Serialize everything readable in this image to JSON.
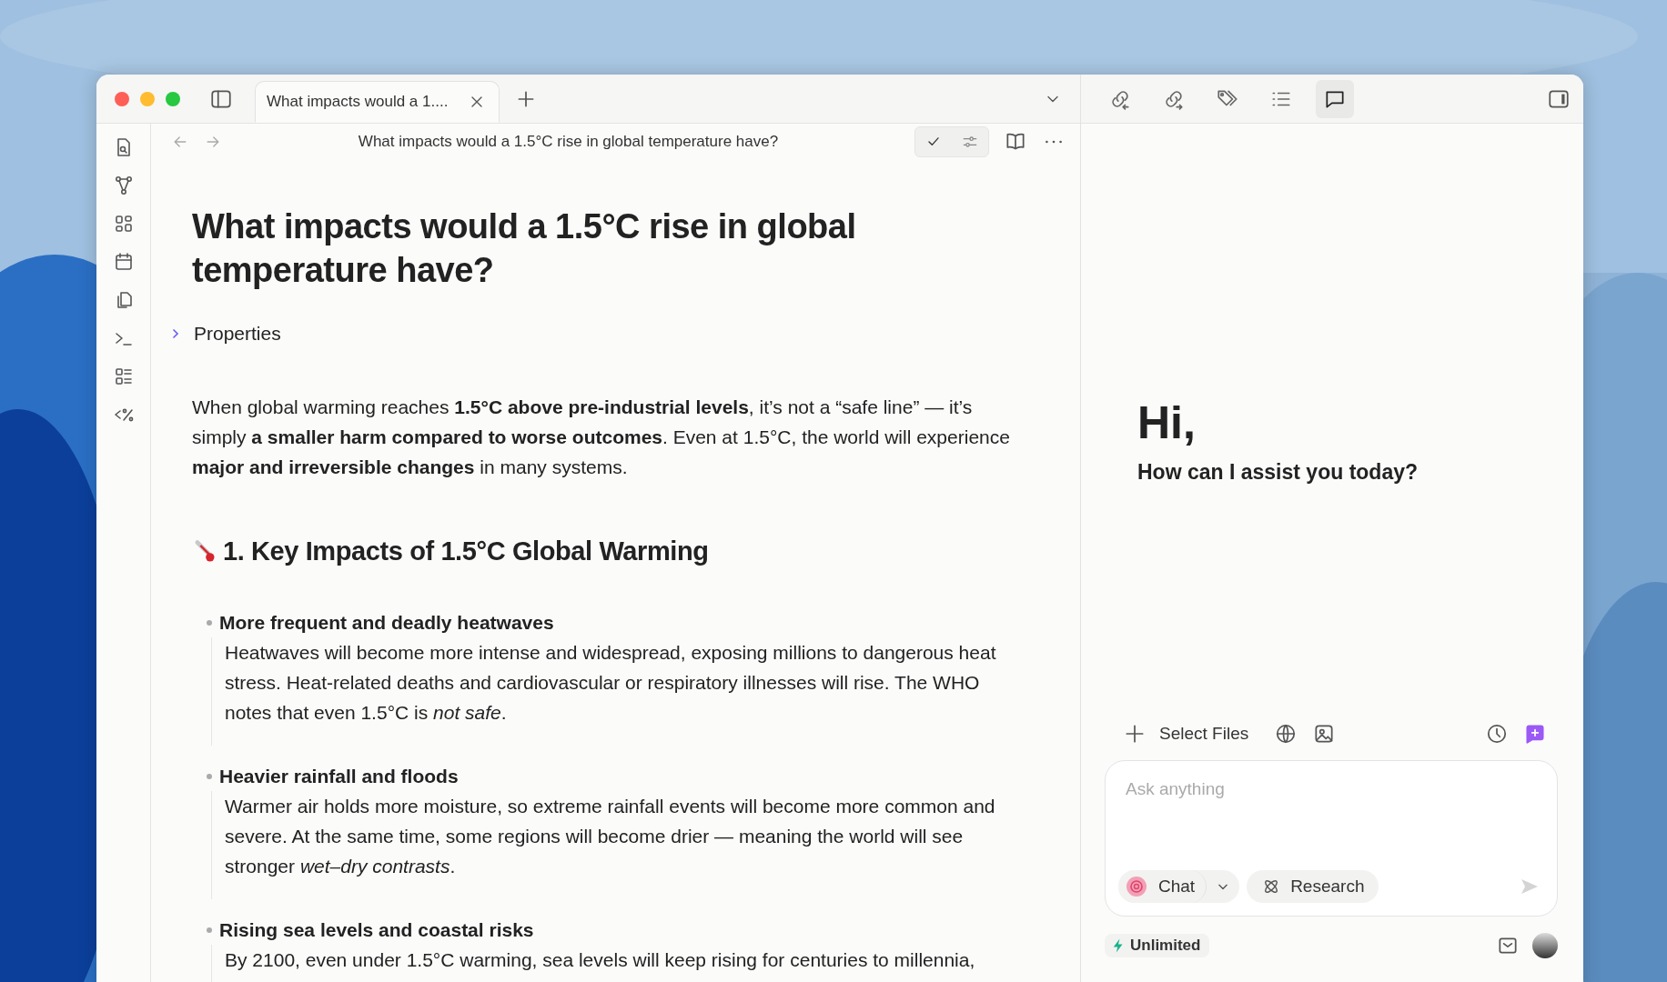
{
  "tabs": [
    {
      "title": "What impacts would a 1....",
      "selected": true
    }
  ],
  "sidebar_tools": [
    {
      "kind": "file-search"
    },
    {
      "kind": "graph"
    },
    {
      "kind": "grid"
    },
    {
      "kind": "calendar"
    },
    {
      "kind": "copy"
    },
    {
      "kind": "terminal"
    },
    {
      "kind": "list"
    },
    {
      "kind": "template"
    }
  ],
  "right_tools": [
    {
      "kind": "link-in",
      "selected": false
    },
    {
      "kind": "link-out",
      "selected": false
    },
    {
      "kind": "tags",
      "selected": false
    },
    {
      "kind": "outline",
      "selected": false
    },
    {
      "kind": "chat",
      "selected": true
    }
  ],
  "nav_title": "What impacts would a 1.5°C rise in global temperature have?",
  "view_modes": [
    {
      "kind": "check",
      "selected": true
    },
    {
      "kind": "sliders",
      "selected": false
    }
  ],
  "page": {
    "title": "What impacts would a 1.5°C rise in global temperature have?",
    "properties": {
      "label": "Properties",
      "expanded": false
    },
    "intro": "When global warming reaches **1.5°C above pre-industrial levels**, it’s not a “safe line” — it’s simply **a smaller harm compared to worse outcomes**. Even at 1.5°C, the world will experience **major and irreversible changes** in many systems.",
    "section": "1. Key Impacts of 1.5°C Global Warming",
    "items": [
      {
        "title": "More frequent and deadly heatwaves",
        "text": "Heatwaves will become more intense and widespread, exposing millions to dangerous heat stress. Heat-related deaths and cardiovascular or respiratory illnesses will rise. The WHO notes that even 1.5°C is *not safe*."
      },
      {
        "title": "Heavier rainfall and floods",
        "text": "Warmer air holds more moisture, so extreme rainfall events will become more common and severe. At the same time, some regions will become drier — meaning the world will see stronger *wet–dry contrasts*."
      },
      {
        "title": "Rising sea levels and coastal risks",
        "text": "By 2100, even under 1.5°C warming, sea levels will keep rising for centuries to millennia,"
      }
    ]
  },
  "assistant": {
    "greeting": "Hi,",
    "prompt": "How can I assist you today?",
    "select_files": "Select Files",
    "input": {
      "placeholder": "Ask anything"
    },
    "mode": "Chat",
    "research": "Research",
    "plan": "Unlimited"
  }
}
